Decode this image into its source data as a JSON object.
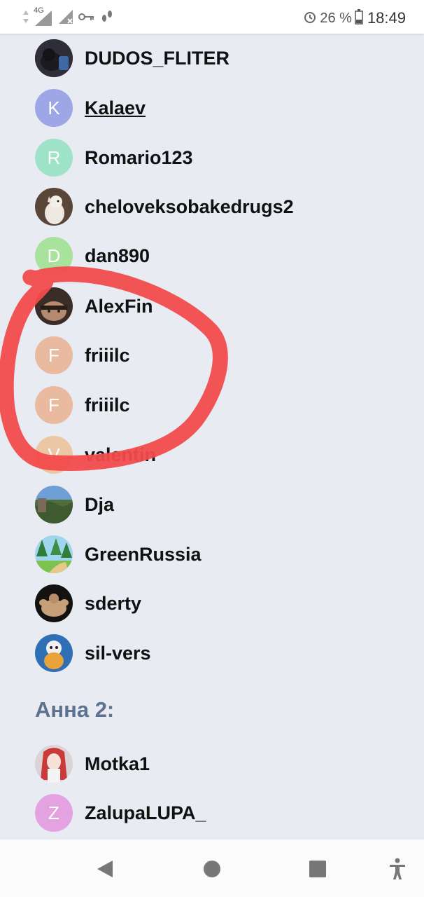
{
  "status_bar": {
    "network": "4G",
    "battery_percent": "26 %",
    "time": "18:49"
  },
  "members": [
    {
      "name": "DUDOS_FLITER",
      "avatar_type": "photo",
      "avatar_icon": "dark-cat-photo-avatar",
      "color": "#3a3a44"
    },
    {
      "name": "Kalaev",
      "avatar_type": "letter",
      "letter": "K",
      "color": "#9ea6e8",
      "underlined": true
    },
    {
      "name": "Romario123",
      "avatar_type": "letter",
      "letter": "R",
      "color": "#9ee3c8"
    },
    {
      "name": "cheloveksobakedrugs2",
      "avatar_type": "photo",
      "avatar_icon": "cartoon-dog-avatar",
      "color": "#d8c4b0"
    },
    {
      "name": "dan890",
      "avatar_type": "letter",
      "letter": "D",
      "color": "#a9e29c"
    },
    {
      "name": "AlexFin",
      "avatar_type": "photo",
      "avatar_icon": "face-photo-avatar",
      "color": "#6b5448"
    },
    {
      "name": "friiilc",
      "avatar_type": "letter",
      "letter": "F",
      "color": "#e9b9a0"
    },
    {
      "name": "friiilc",
      "avatar_type": "letter",
      "letter": "F",
      "color": "#e9b9a0"
    },
    {
      "name": "valentin",
      "avatar_type": "letter",
      "letter": "V",
      "color": "#ebc7a5"
    },
    {
      "name": "Dja",
      "avatar_type": "photo",
      "avatar_icon": "landscape-photo-avatar",
      "color": "#5a7a4a"
    },
    {
      "name": "GreenRussia",
      "avatar_type": "photo",
      "avatar_icon": "forest-avatar",
      "color": "#4e9a52"
    },
    {
      "name": "sderty",
      "avatar_type": "photo",
      "avatar_icon": "bodybuilder-avatar",
      "color": "#2a2420"
    },
    {
      "name": "sil-vers",
      "avatar_type": "photo",
      "avatar_icon": "cartoon-character-avatar",
      "color": "#3b6fb0"
    }
  ],
  "section": {
    "title": "Анна 2:",
    "members": [
      {
        "name": "Motka1",
        "avatar_type": "photo",
        "avatar_icon": "anime-girl-avatar",
        "color": "#d9c8c8"
      },
      {
        "name": "ZalupaLUPA_",
        "avatar_type": "letter",
        "letter": "Z",
        "color": "#e4a2e0"
      }
    ]
  },
  "nav": {
    "back": "back-icon",
    "home": "home-icon",
    "recents": "recents-icon",
    "accessibility": "accessibility-icon"
  },
  "annotation_color": "#f24b4b"
}
